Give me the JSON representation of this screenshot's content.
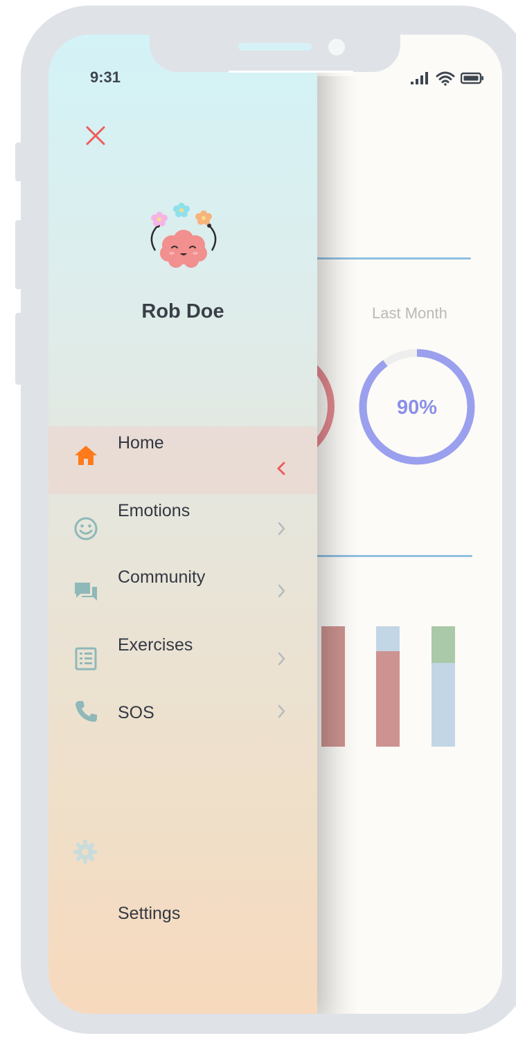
{
  "status_bar": {
    "time": "9:31"
  },
  "user": {
    "name": "Rob Doe"
  },
  "menu": {
    "items": [
      {
        "label": "Home",
        "icon": "home-icon",
        "active": true
      },
      {
        "label": "Emotions",
        "icon": "smiley-icon"
      },
      {
        "label": "Community",
        "icon": "chat-icon"
      },
      {
        "label": "Exercises",
        "icon": "list-icon"
      },
      {
        "label": "SOS",
        "icon": "phone-icon"
      }
    ],
    "settings_label": "Settings"
  },
  "background": {
    "period_label": "Last Month",
    "last_month_percent": "90%",
    "last_month_value": 0.9
  },
  "colors": {
    "accent_orange": "#ff7a1a",
    "close_red": "#f05a5a",
    "icon_teal": "#8fb8b8",
    "ring_purple": "#9aa0ee",
    "ring_red": "#e58a91"
  }
}
